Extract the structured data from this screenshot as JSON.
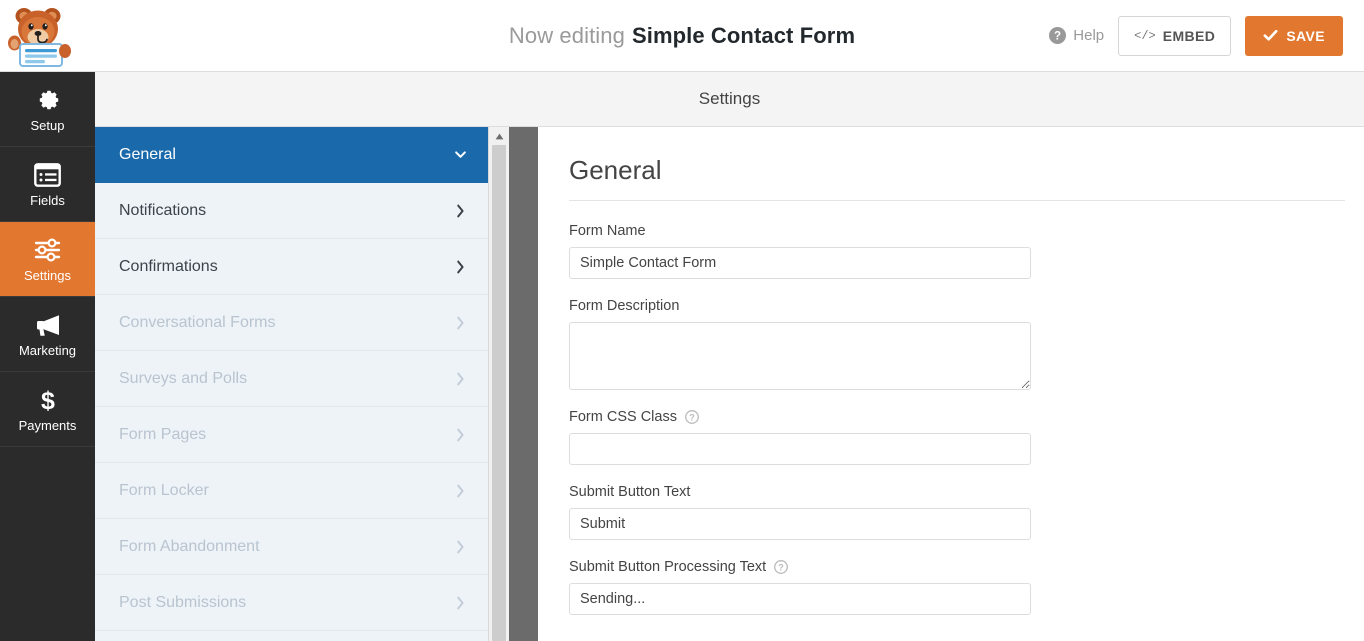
{
  "header": {
    "logo_name": "wpforms-mascot-logo",
    "editing_prefix": "Now editing",
    "form_name": "Simple Contact Form",
    "help_label": "Help",
    "embed_label": "EMBED",
    "embed_icon_text": "</>",
    "save_label": "SAVE",
    "accent_orange": "#e27730"
  },
  "sidebar": {
    "items": [
      {
        "label": "Setup",
        "icon": "gear-icon",
        "active": false
      },
      {
        "label": "Fields",
        "icon": "form-fields-icon",
        "active": false
      },
      {
        "label": "Settings",
        "icon": "sliders-icon",
        "active": true
      },
      {
        "label": "Marketing",
        "icon": "megaphone-icon",
        "active": false
      },
      {
        "label": "Payments",
        "icon": "dollar-icon",
        "active": false
      }
    ]
  },
  "panel": {
    "title": "Settings"
  },
  "settings_list": {
    "items": [
      {
        "label": "General",
        "active": true,
        "disabled": false,
        "chevron": "chevron-down-icon"
      },
      {
        "label": "Notifications",
        "active": false,
        "disabled": false,
        "chevron": "chevron-right-icon"
      },
      {
        "label": "Confirmations",
        "active": false,
        "disabled": false,
        "chevron": "chevron-right-icon"
      },
      {
        "label": "Conversational Forms",
        "active": false,
        "disabled": true,
        "chevron": "chevron-right-icon"
      },
      {
        "label": "Surveys and Polls",
        "active": false,
        "disabled": true,
        "chevron": "chevron-right-icon"
      },
      {
        "label": "Form Pages",
        "active": false,
        "disabled": true,
        "chevron": "chevron-right-icon"
      },
      {
        "label": "Form Locker",
        "active": false,
        "disabled": true,
        "chevron": "chevron-right-icon"
      },
      {
        "label": "Form Abandonment",
        "active": false,
        "disabled": true,
        "chevron": "chevron-right-icon"
      },
      {
        "label": "Post Submissions",
        "active": false,
        "disabled": true,
        "chevron": "chevron-right-icon"
      }
    ],
    "active_bg": "#1a6aab"
  },
  "general": {
    "heading": "General",
    "form_name_label": "Form Name",
    "form_name_value": "Simple Contact Form",
    "form_description_label": "Form Description",
    "form_description_value": "",
    "form_css_class_label": "Form CSS Class",
    "form_css_class_value": "",
    "submit_button_text_label": "Submit Button Text",
    "submit_button_text_value": "Submit",
    "submit_processing_label": "Submit Button Processing Text",
    "submit_processing_value": "Sending..."
  }
}
